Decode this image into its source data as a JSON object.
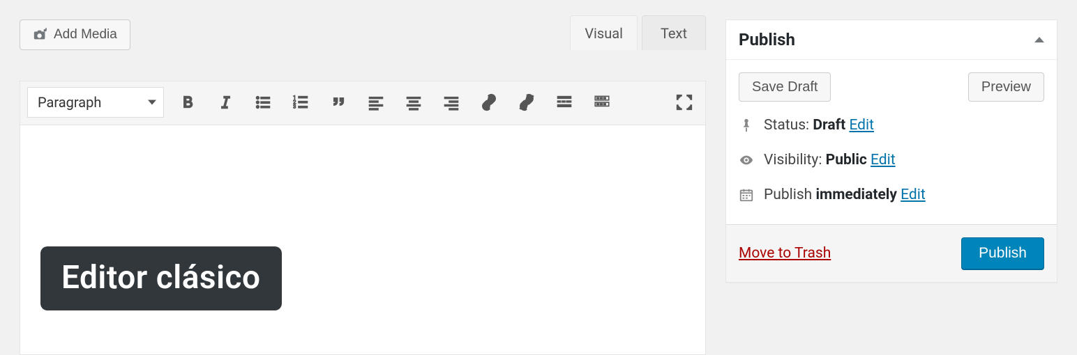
{
  "editor": {
    "add_media_label": "Add Media",
    "tabs": {
      "visual": "Visual",
      "text": "Text",
      "active": "visual"
    },
    "format_select": "Paragraph"
  },
  "publish_box": {
    "title": "Publish",
    "save_draft": "Save Draft",
    "preview": "Preview",
    "status": {
      "label": "Status:",
      "value": "Draft",
      "edit": "Edit"
    },
    "visibility": {
      "label": "Visibility:",
      "value": "Public",
      "edit": "Edit"
    },
    "schedule": {
      "label": "Publish",
      "value": "immediately",
      "edit": "Edit"
    },
    "trash": "Move to Trash",
    "publish_button": "Publish"
  },
  "overlay": {
    "title": "Editor clásico"
  }
}
